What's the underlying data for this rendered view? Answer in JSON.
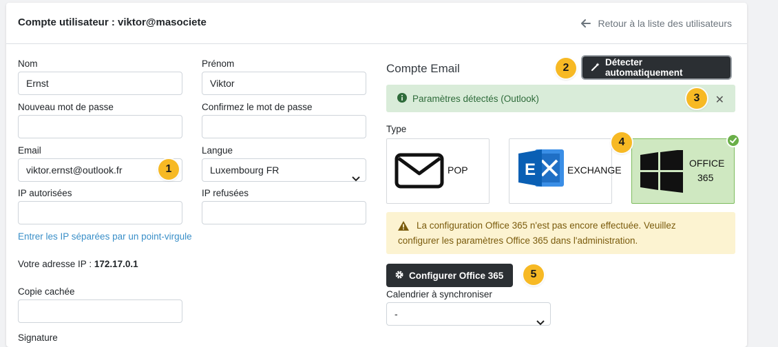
{
  "header": {
    "title": "Compte utilisateur : viktor@masociete",
    "back_label": "Retour à la liste des utilisateurs"
  },
  "form": {
    "nom": {
      "label": "Nom",
      "value": "Ernst"
    },
    "prenom": {
      "label": "Prénom",
      "value": "Viktor"
    },
    "new_password": {
      "label": "Nouveau mot de passe",
      "value": ""
    },
    "confirm_password": {
      "label": "Confirmez le mot de passe",
      "value": ""
    },
    "email": {
      "label": "Email",
      "value": "viktor.ernst@outlook.fr"
    },
    "langue": {
      "label": "Langue",
      "value": "Luxembourg FR"
    },
    "ip_allowed": {
      "label": "IP autorisées",
      "value": ""
    },
    "ip_denied": {
      "label": "IP refusées",
      "value": ""
    },
    "ip_hint": "Entrer les IP séparées par un point-virgule",
    "ip_prefix": "Votre adresse IP : ",
    "ip_value": "172.17.0.1",
    "bcc": {
      "label": "Copie cachée",
      "value": ""
    },
    "signature_label": "Signature"
  },
  "email_account": {
    "title": "Compte Email",
    "detect_button": "Détecter automatiquement",
    "detected_message": "Paramètres détectés (Outlook)",
    "type_label": "Type",
    "types": [
      {
        "label": "POP",
        "selected": false
      },
      {
        "label": "EXCHANGE",
        "selected": false
      },
      {
        "label_line1": "OFFICE",
        "label_line2": "365",
        "selected": true
      }
    ],
    "warning_line1": "La configuration Office 365 n'est pas encore effectuée. Veuillez",
    "warning_line2": "configurer les paramètres Office 365 dans l'administration.",
    "configure_button": "Configurer Office 365",
    "calendar_label": "Calendrier à synchroniser",
    "calendar_value": "-"
  },
  "badges": [
    "1",
    "2",
    "3",
    "4",
    "5"
  ],
  "colors": {
    "badge": "#f7b924",
    "selected_card": "#cfe8c1",
    "success_alert": "#d9ecd9",
    "warning_alert": "#fcf3d1",
    "dark_button": "#2b2f33",
    "link": "#3a8fc8"
  },
  "icons": [
    "arrow-left-icon",
    "magic-wand-icon",
    "info-circle-icon",
    "close-icon",
    "envelope-icon",
    "exchange-logo-icon",
    "windows-logo-icon",
    "check-icon",
    "warning-triangle-icon",
    "gear-icon",
    "chevron-down-icon"
  ]
}
